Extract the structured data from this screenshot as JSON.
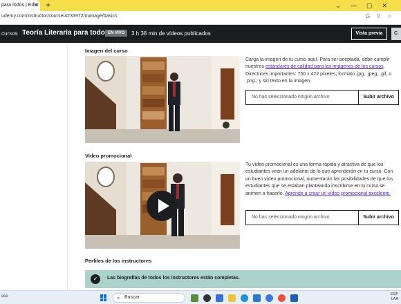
{
  "browser": {
    "tab_title": "para todos | Edic",
    "url": "udemy.com/instructor/course/4233972/manage/basics"
  },
  "header": {
    "back_label": "cursos",
    "course_title": "Teoría Literaria para todos",
    "status_badge": "EN VIVO",
    "published_info": "3 h 38 min de vídeos publicados",
    "preview_button": "Vista previa",
    "more_button": "C"
  },
  "course_image": {
    "title": "Imagen del curso",
    "desc_before": "Carga la imagen de tu curso aquí. Para ser aceptada, debe cumplir nuestros ",
    "desc_link": "estándares de calidad para las imágenes de los cursos",
    "desc_after": ". Directrices importantes: 750 x 422 píxeles; formato .jpg, .jpeg, .gif, o .png.; y sin texto en la imagen.",
    "file_text": "No has seleccionado ningún archivo",
    "upload_button": "Subir archivo"
  },
  "promo_video": {
    "title": "Video promocional",
    "desc_before": "Tu vídeo promocional es una forma rápida y atractiva de que los estudiantes vean un adelanto de lo que aprenderán en tu curso. Con un buen vídeo promocional, aumentarán las posibilidades de que los estudiantes que se estaban planteando inscribirse en tu curso se animen a hacerlo. ",
    "desc_link": "Aprende a crear un vídeo promocional excelente.",
    "file_text": "No has seleccionado ningún archivo",
    "upload_button": "Subir archivo"
  },
  "instructors": {
    "title": "Perfiles de los instructores",
    "banner_text": "Las biografías de todos los instructores están completas."
  },
  "taskbar": {
    "left_text": "oso",
    "search_placeholder": "Buscar",
    "lang": "ESP",
    "region": "LAA"
  }
}
